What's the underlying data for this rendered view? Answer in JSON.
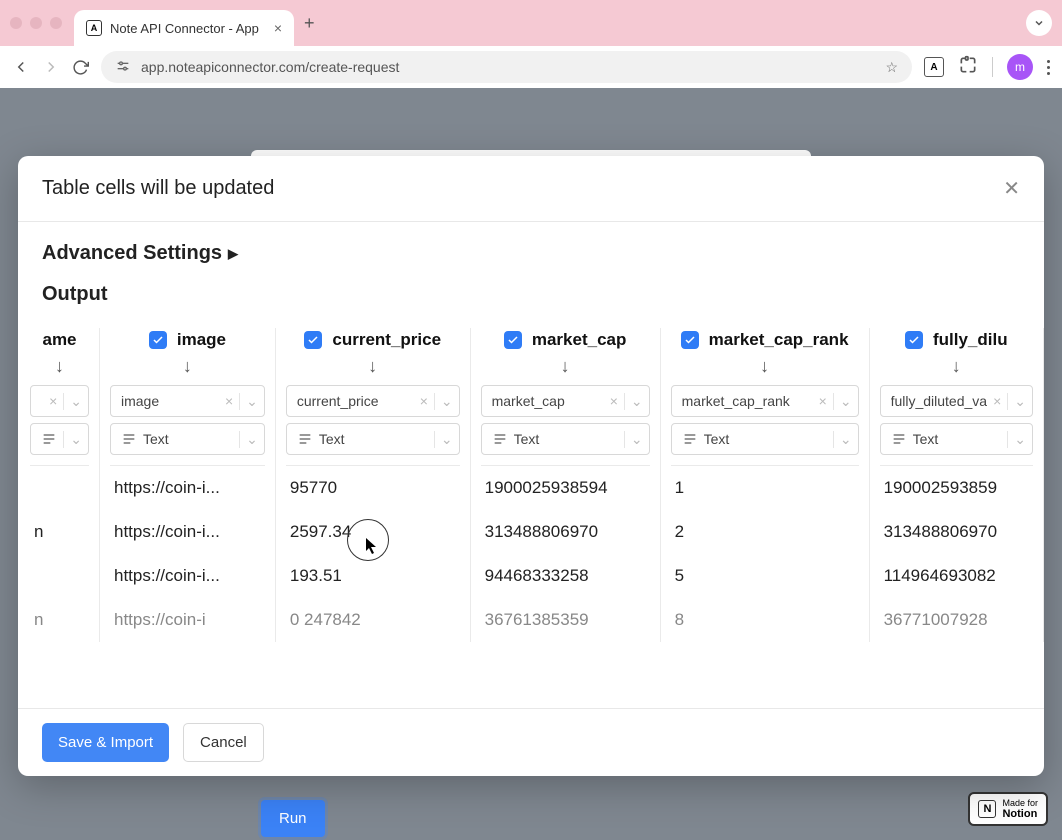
{
  "browser": {
    "tab_title": "Note API Connector - App",
    "url": "app.noteapiconnector.com/create-request",
    "avatar_letter": "m"
  },
  "page": {
    "run_label": "Run",
    "notion_badge": {
      "line1": "Made for",
      "line2": "Notion"
    }
  },
  "modal": {
    "title": "Table cells will be updated",
    "advanced_label": "Advanced Settings",
    "output_label": "Output",
    "save_label": "Save & Import",
    "cancel_label": "Cancel",
    "type_label": "Text",
    "columns": [
      {
        "header": "ame",
        "field": "",
        "rows": [
          "",
          "n",
          "",
          "n"
        ]
      },
      {
        "header": "image",
        "field": "image",
        "rows": [
          "https://coin-i...",
          "https://coin-i...",
          "https://coin-i...",
          "https://coin-i"
        ]
      },
      {
        "header": "current_price",
        "field": "current_price",
        "rows": [
          "95770",
          "2597.34",
          "193.51",
          "0 247842"
        ]
      },
      {
        "header": "market_cap",
        "field": "market_cap",
        "rows": [
          "1900025938594",
          "313488806970",
          "94468333258",
          "36761385359"
        ]
      },
      {
        "header": "market_cap_rank",
        "field": "market_cap_rank",
        "rows": [
          "1",
          "2",
          "5",
          "8"
        ]
      },
      {
        "header": "fully_dilu",
        "field": "fully_diluted_va",
        "rows": [
          "190002593859",
          "313488806970",
          "114964693082",
          "36771007928"
        ]
      }
    ]
  }
}
